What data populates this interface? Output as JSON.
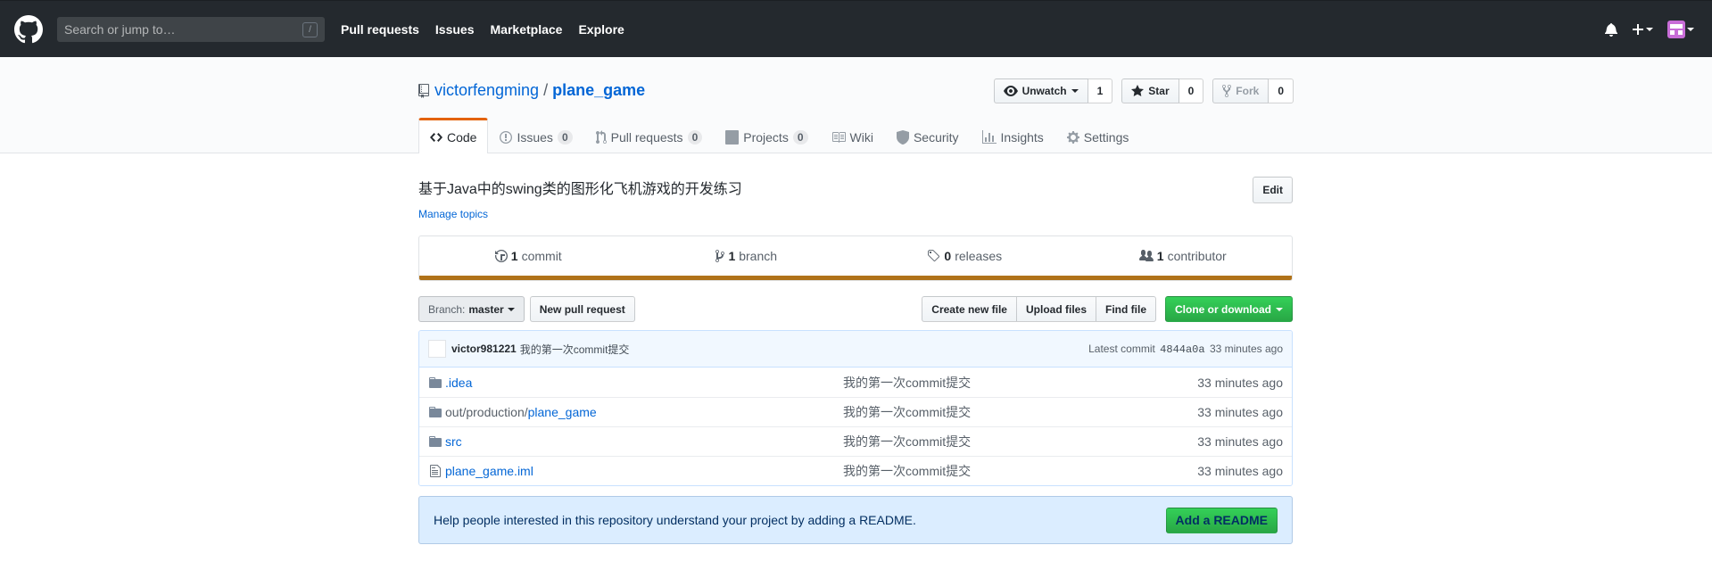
{
  "header": {
    "search_placeholder": "Search or jump to…",
    "search_shortcut": "/",
    "nav": [
      "Pull requests",
      "Issues",
      "Marketplace",
      "Explore"
    ]
  },
  "repo": {
    "owner": "victorfengming",
    "separator": "/",
    "name": "plane_game",
    "unwatch_label": "Unwatch",
    "watch_count": "1",
    "star_label": "Star",
    "star_count": "0",
    "fork_label": "Fork",
    "fork_count": "0"
  },
  "tabs": [
    {
      "label": "Code",
      "counter": null,
      "icon": "code-icon",
      "selected": true
    },
    {
      "label": "Issues",
      "counter": "0",
      "icon": "issue-icon"
    },
    {
      "label": "Pull requests",
      "counter": "0",
      "icon": "pull-request-icon"
    },
    {
      "label": "Projects",
      "counter": "0",
      "icon": "project-icon"
    },
    {
      "label": "Wiki",
      "counter": null,
      "icon": "book-icon"
    },
    {
      "label": "Security",
      "counter": null,
      "icon": "shield-icon"
    },
    {
      "label": "Insights",
      "counter": null,
      "icon": "graph-icon"
    },
    {
      "label": "Settings",
      "counter": null,
      "icon": "gear-icon"
    }
  ],
  "description": "基于Java中的swing类的图形化飞机游戏的开发练习",
  "edit_label": "Edit",
  "manage_topics": "Manage topics",
  "summary": {
    "commits_num": "1",
    "commits_label": "commit",
    "branches_num": "1",
    "branches_label": "branch",
    "releases_num": "0",
    "releases_label": "releases",
    "contributors_num": "1",
    "contributors_label": "contributor",
    "language_color": "#b07219"
  },
  "filebar": {
    "branch_prefix": "Branch:",
    "branch_name": "master",
    "new_pr": "New pull request",
    "create_file": "Create new file",
    "upload_files": "Upload files",
    "find_file": "Find file",
    "clone": "Clone or download"
  },
  "commit": {
    "author": "victor981221",
    "message": "我的第一次commit提交",
    "latest_prefix": "Latest commit",
    "sha": "4844a0a",
    "age": "33 minutes ago"
  },
  "files": [
    {
      "type": "dir",
      "prefix": "",
      "name": ".idea",
      "message": "我的第一次commit提交",
      "age": "33 minutes ago"
    },
    {
      "type": "dir",
      "prefix": "out/production/",
      "name": "plane_game",
      "message": "我的第一次commit提交",
      "age": "33 minutes ago"
    },
    {
      "type": "dir",
      "prefix": "",
      "name": "src",
      "message": "我的第一次commit提交",
      "age": "33 minutes ago"
    },
    {
      "type": "file",
      "prefix": "",
      "name": "plane_game.iml",
      "message": "我的第一次commit提交",
      "age": "33 minutes ago"
    }
  ],
  "readme": {
    "text": "Help people interested in this repository understand your project by adding a README.",
    "button": "Add a README"
  }
}
